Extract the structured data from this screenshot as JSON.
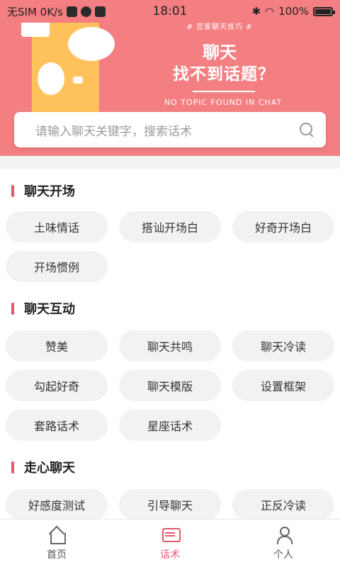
{
  "status_bar": {
    "carrier": "无SIM 0K/s",
    "time": "18:01",
    "battery": "100%"
  },
  "banner": {
    "tag": "# 恋爱聊天技巧 #",
    "title_line1": "聊天",
    "title_line2": "找不到话题？",
    "subtitle": "NO TOPIC FOUND IN CHAT"
  },
  "search": {
    "placeholder": "请输入聊天关键字，搜索话术",
    "icon": "search-icon"
  },
  "sections": [
    {
      "title": "聊天开场",
      "chips": [
        "土味情话",
        "搭讪开场白",
        "好奇开场白",
        "开场惯例"
      ]
    },
    {
      "title": "聊天互动",
      "chips": [
        "赞美",
        "聊天共鸣",
        "聊天冷读",
        "勾起好奇",
        "聊天模版",
        "设置框架",
        "套路话术",
        "星座话术"
      ]
    },
    {
      "title": "走心聊天",
      "chips": [
        "好感度测试",
        "引导聊天",
        "正反冷读"
      ]
    }
  ],
  "tabbar": {
    "tabs": [
      {
        "label": "首页",
        "icon": "home-icon"
      },
      {
        "label": "话术",
        "icon": "chat-icon"
      },
      {
        "label": "个人",
        "icon": "user-icon"
      }
    ],
    "active": "话术"
  },
  "colors": {
    "accent": "#e8566a",
    "banner": "#f47f82",
    "phone_deco": "#ffc15c"
  }
}
